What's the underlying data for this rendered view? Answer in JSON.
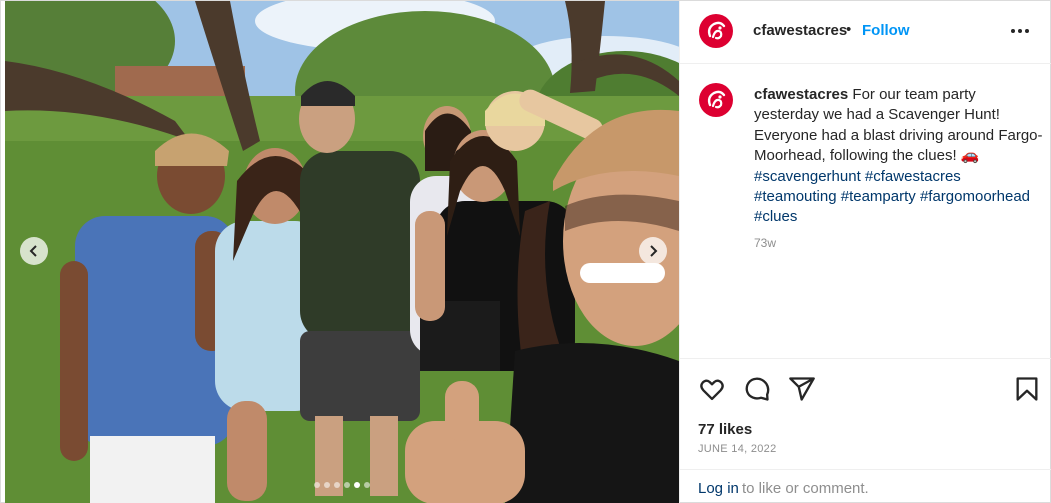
{
  "account": {
    "username": "cfawestacres",
    "follow_label": "Follow",
    "separator": "•",
    "brand_color": "#dd0031"
  },
  "caption": {
    "username": "cfawestacres",
    "text": "For our team party yesterday we had a Scavenger Hunt! Everyone had a blast driving around Fargo-Moorhead, following the clues!",
    "emoji": "🚗",
    "hashtags": [
      "#scavengerhunt",
      "#cfawestacres",
      "#teamouting",
      "#teamparty",
      "#fargomoorhead",
      "#clues"
    ],
    "time_ago": "73w"
  },
  "engagement": {
    "likes": "77 likes",
    "date": "JUNE 14, 2022"
  },
  "footer": {
    "login_label": "Log in",
    "rest_text": "to like or comment."
  },
  "carousel": {
    "slide_count": 6,
    "active_index": 4
  },
  "icons": {
    "like": "heart-icon",
    "comment": "comment-icon",
    "share": "share-icon",
    "save": "bookmark-icon",
    "more": "more-horizontal-icon",
    "prev": "chevron-left-icon",
    "next": "chevron-right-icon"
  },
  "colors": {
    "link": "#00376b",
    "follow": "#0095f6",
    "muted": "#8e8e8e"
  }
}
